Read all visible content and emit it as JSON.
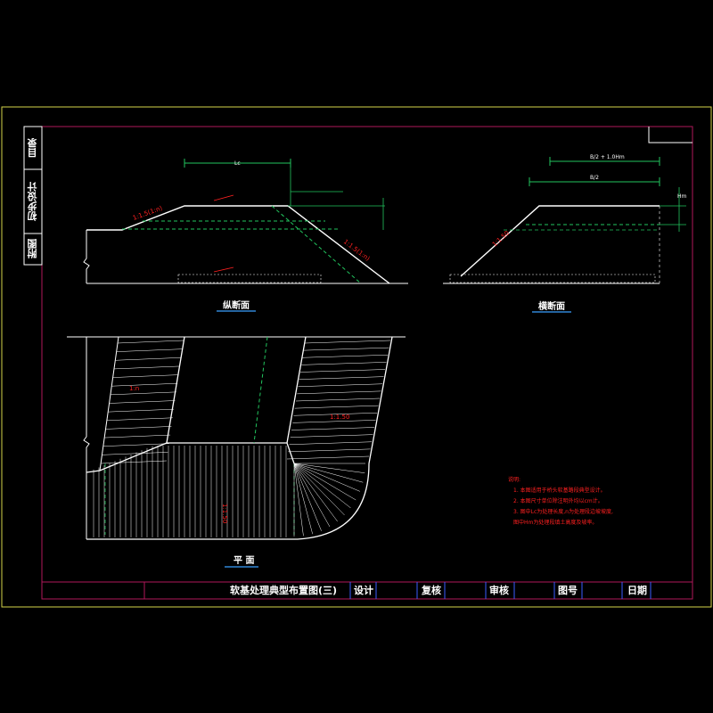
{
  "sidebar": {
    "tabs": [
      {
        "label": "目录"
      },
      {
        "label": "初步设计"
      },
      {
        "label": "附图"
      }
    ]
  },
  "views": {
    "longitudinal": {
      "title": "纵断面"
    },
    "cross": {
      "title": "横断面"
    },
    "plan": {
      "title": "平 面"
    }
  },
  "dims": {
    "long_top": "Lc",
    "cross_top": "B/2 + 1.0Hm",
    "cross_second": "B/2",
    "cross_side": "Hm"
  },
  "slopes": {
    "long_left": "1:1.5(1:n)",
    "long_right": "1:1.5(1:n)",
    "cross": "1:1.50",
    "plan_left": "1:n",
    "plan_right": "1:1.50",
    "plan_center": "1:1.50"
  },
  "title_block": {
    "drawing_title": "软基处理典型布置图(三)",
    "design": "设计",
    "check": "复核",
    "review": "审核",
    "drawing_no": "图号",
    "date": "日期"
  },
  "notes": {
    "heading": "说明:",
    "items": [
      "1. 本图适用于桥头软基路段典型设计。",
      "2. 本图尺寸单位除注明外均以cm计。",
      "3. 图中Lc为处理长度,n为处理段边坡坡度,",
      "   图中Hm为处理段填土高度及坡率。"
    ]
  },
  "colors": {
    "background": "#000000",
    "frame": "#d4d44a",
    "inner_frame": "#b0185a",
    "line": "#ffffff",
    "dimension": "#22c55e",
    "annotation": "#ff2020",
    "title_underline": "#3aa0ff"
  }
}
